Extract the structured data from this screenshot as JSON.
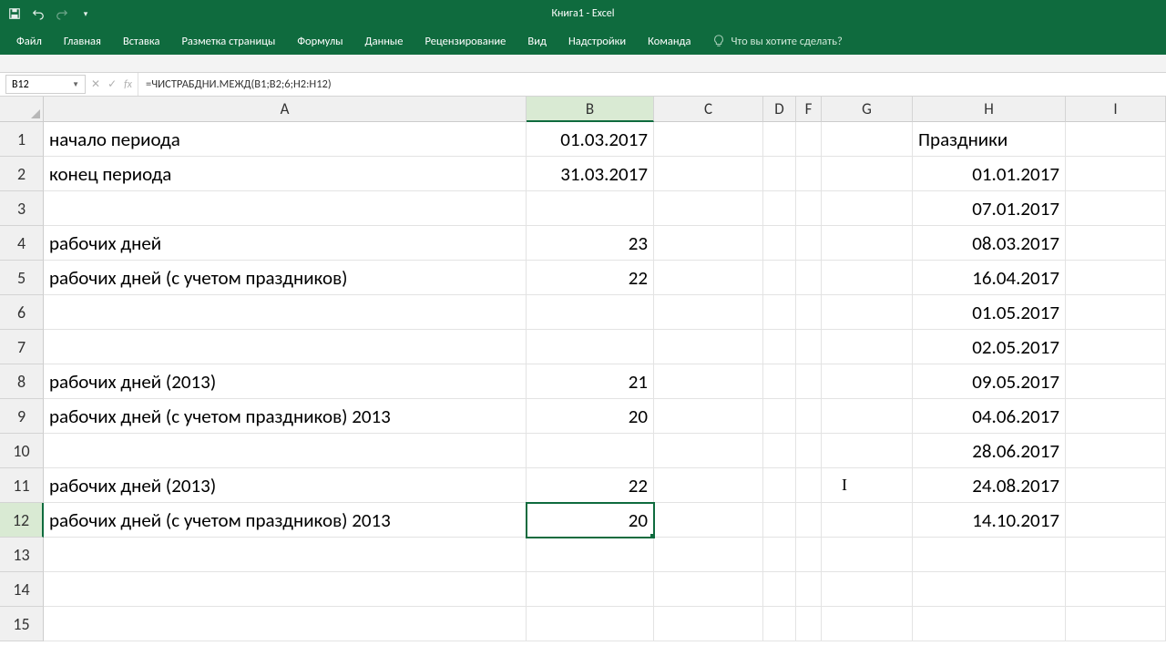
{
  "app": {
    "title": "Книга1  -  Excel"
  },
  "ribbon": {
    "tabs": [
      "Файл",
      "Главная",
      "Вставка",
      "Разметка страницы",
      "Формулы",
      "Данные",
      "Рецензирование",
      "Вид",
      "Надстройки",
      "Команда"
    ],
    "tellme": "Что вы хотите сделать?"
  },
  "formula_bar": {
    "name_box": "B12",
    "formula": "=ЧИСТРАБДНИ.МЕЖД(B1;B2;6;H2:H12)"
  },
  "columns": [
    "A",
    "B",
    "C",
    "D",
    "F",
    "G",
    "H",
    "I"
  ],
  "selected_col_index": 1,
  "rows": [
    1,
    2,
    3,
    4,
    5,
    6,
    7,
    8,
    9,
    10,
    11,
    12,
    13,
    14,
    15
  ],
  "selected_row_index": 11,
  "cells": {
    "A": [
      "начало периода",
      "конец периода",
      "",
      "рабочих дней",
      "рабочих дней (с учетом праздников)",
      "",
      "",
      "рабочих дней (2013)",
      "рабочих дней (с учетом праздников) 2013",
      "",
      "рабочих дней (2013)",
      "рабочих дней (с учетом праздников) 2013",
      "",
      "",
      ""
    ],
    "B": [
      "01.03.2017",
      "31.03.2017",
      "",
      "23",
      "22",
      "",
      "",
      "21",
      "20",
      "",
      "22",
      "20",
      "",
      "",
      ""
    ],
    "H": [
      "Праздники",
      "01.01.2017",
      "07.01.2017",
      "08.03.2017",
      "16.04.2017",
      "01.05.2017",
      "02.05.2017",
      "09.05.2017",
      "04.06.2017",
      "28.06.2017",
      "24.08.2017",
      "14.10.2017",
      "",
      "",
      ""
    ]
  },
  "H_align": [
    "l",
    "r",
    "r",
    "r",
    "r",
    "r",
    "r",
    "r",
    "r",
    "r",
    "r",
    "r",
    "",
    "",
    ""
  ],
  "B_align": [
    "r",
    "r",
    "",
    "r",
    "r",
    "",
    "",
    "r",
    "r",
    "",
    "r",
    "r",
    "",
    "",
    ""
  ]
}
